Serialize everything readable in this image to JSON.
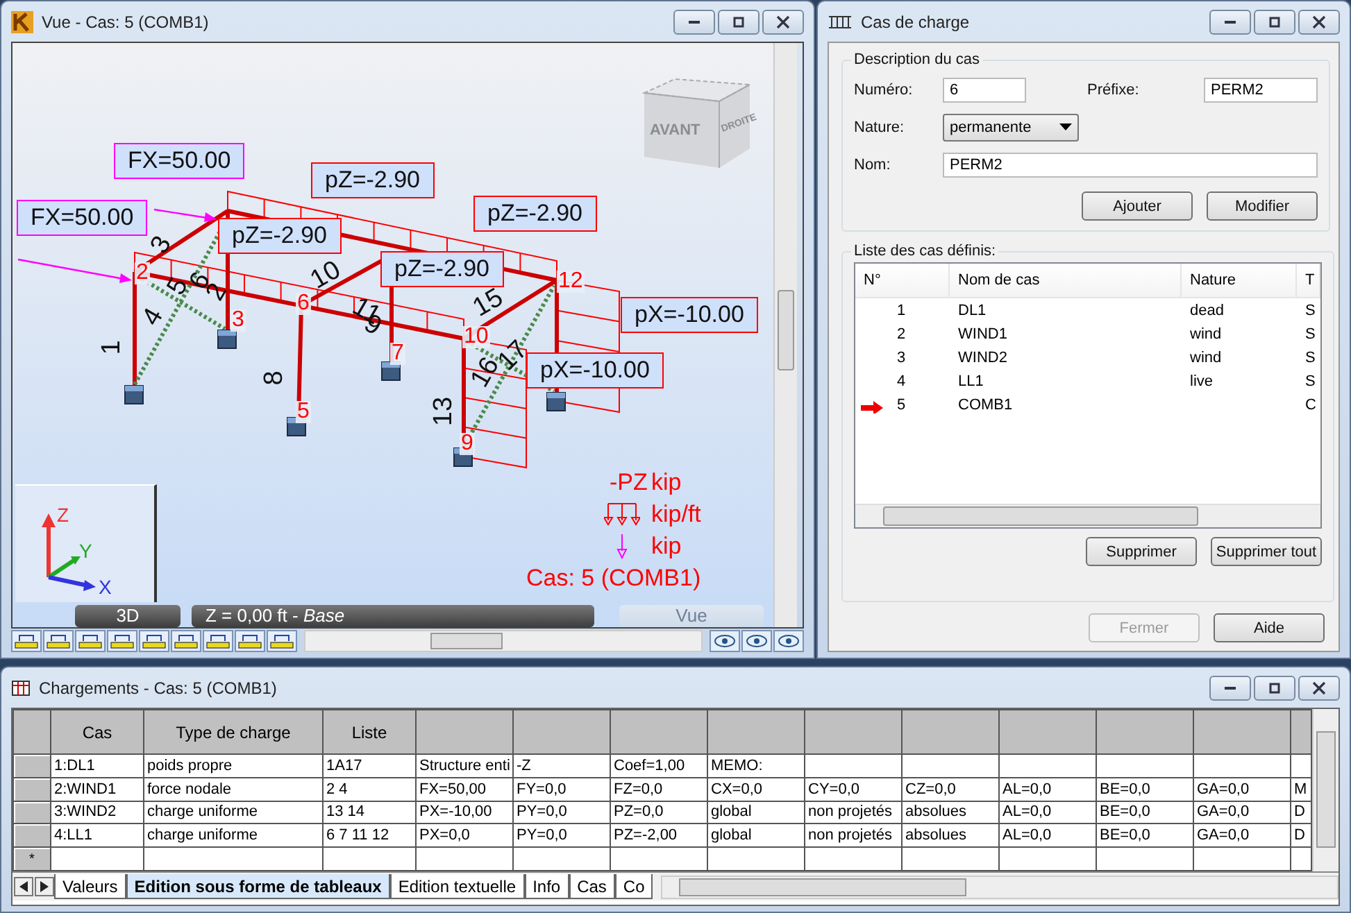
{
  "view_window": {
    "title": "Vue - Cas: 5 (COMB1)",
    "view_cube": {
      "front": "AVANT",
      "right": "DROITE"
    },
    "load_labels": [
      {
        "text": "FX=50.00",
        "kind": "force"
      },
      {
        "text": "FX=50.00",
        "kind": "force"
      },
      {
        "text": "pZ=-2.90",
        "kind": "load"
      },
      {
        "text": "pZ=-2.90",
        "kind": "load"
      },
      {
        "text": "pZ=-2.90",
        "kind": "load"
      },
      {
        "text": "pZ=-2.90",
        "kind": "load"
      },
      {
        "text": "pX=-10.00",
        "kind": "load"
      },
      {
        "text": "pX=-10.00",
        "kind": "load"
      }
    ],
    "member_numbers": [
      "1",
      "3",
      "4",
      "5",
      "6",
      "2",
      "10",
      "11",
      "9",
      "15",
      "17",
      "16",
      "13",
      "8"
    ],
    "node_numbers": [
      "2",
      "3",
      "6",
      "5",
      "7",
      "10",
      "12",
      "9"
    ],
    "axes": {
      "z": "Z",
      "y": "Y",
      "x": "X"
    },
    "legend": {
      "component": "-PZ",
      "force_unit": "kip",
      "distributed_unit": "kip/ft",
      "nodal_unit": "kip",
      "case": "Cas: 5 (COMB1)"
    },
    "view_bar": {
      "mode": "3D",
      "plane": "Z = 0,00 ft - *Base*",
      "view_button": {
        "label": "Vue",
        "disabled": true
      }
    }
  },
  "load_case_window": {
    "title": "Cas de charge",
    "description_group": "Description du cas",
    "number_label": "Numéro:",
    "number": "6",
    "prefix_label": "Préfixe:",
    "prefix": "PERM2",
    "nature_label": "Nature:",
    "nature": "permanente",
    "name_label": "Nom:",
    "name": "PERM2",
    "buttons": [
      {
        "label": "Ajouter",
        "disabled": false
      },
      {
        "label": "Modifier",
        "disabled": false
      }
    ],
    "list_group": "Liste des cas définis:",
    "list": {
      "columns": [
        "N°",
        "Nom de cas",
        "Nature",
        "T"
      ],
      "rows": [
        {
          "cells": [
            "1",
            "DL1",
            "dead",
            "S"
          ],
          "current": false
        },
        {
          "cells": [
            "2",
            "WIND1",
            "wind",
            "S"
          ],
          "current": false
        },
        {
          "cells": [
            "3",
            "WIND2",
            "wind",
            "S"
          ],
          "current": false
        },
        {
          "cells": [
            "4",
            "LL1",
            "live",
            "S"
          ],
          "current": false
        },
        {
          "cells": [
            "5",
            "COMB1",
            "",
            "C"
          ],
          "current": true
        }
      ]
    },
    "list_buttons": [
      {
        "label": "Supprimer",
        "disabled": false
      },
      {
        "label": "Supprimer tout",
        "disabled": false
      }
    ],
    "footer_buttons": [
      {
        "label": "Fermer",
        "disabled": true
      },
      {
        "label": "Aide",
        "disabled": false
      }
    ]
  },
  "loads_window": {
    "title": "Chargements - Cas: 5 (COMB1)",
    "table": {
      "columns": [
        "Cas",
        "Type de charge",
        "Liste"
      ],
      "rows": [
        [
          "1:DL1",
          "poids propre",
          "1A17",
          "Structure enti",
          "-Z",
          "Coef=1,00",
          "MEMO:",
          "",
          "",
          "",
          "",
          "",
          ""
        ],
        [
          "2:WIND1",
          "force nodale",
          "2 4",
          "FX=50,00",
          "FY=0,0",
          "FZ=0,0",
          "CX=0,0",
          "CY=0,0",
          "CZ=0,0",
          "AL=0,0",
          "BE=0,0",
          "GA=0,0",
          "M"
        ],
        [
          "3:WIND2",
          "charge uniforme",
          "13 14",
          "PX=-10,00",
          "PY=0,0",
          "PZ=0,0",
          "global",
          "non projetés",
          "absolues",
          "AL=0,0",
          "BE=0,0",
          "GA=0,0",
          "D"
        ],
        [
          "4:LL1",
          "charge uniforme",
          "6 7 11 12",
          "PX=0,0",
          "PY=0,0",
          "PZ=-2,00",
          "global",
          "non projetés",
          "absolues",
          "AL=0,0",
          "BE=0,0",
          "GA=0,0",
          "D"
        ]
      ],
      "new_row_marker": "*"
    },
    "tabs": [
      {
        "label": "Valeurs",
        "selected": false
      },
      {
        "label": "Edition sous forme de tableaux",
        "selected": true
      },
      {
        "label": "Edition textuelle",
        "selected": false
      },
      {
        "label": "Info",
        "selected": false
      },
      {
        "label": "Cas",
        "selected": false
      },
      {
        "label": "Co",
        "selected": false
      }
    ]
  }
}
